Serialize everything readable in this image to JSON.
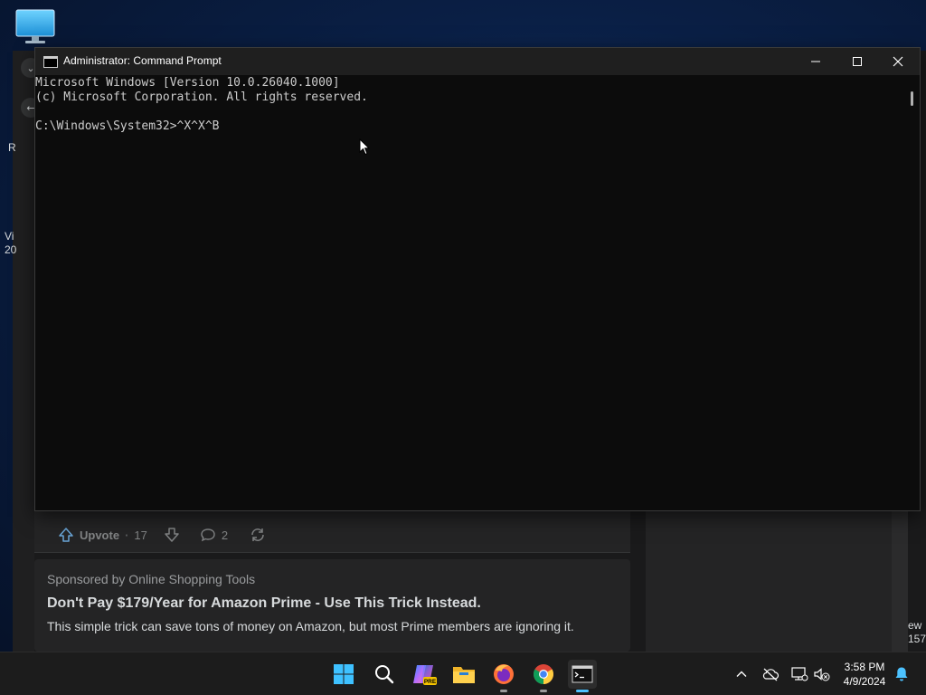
{
  "cmd": {
    "title": "Administrator: Command Prompt",
    "lines": [
      "Microsoft Windows [Version 10.0.26040.1000]",
      "(c) Microsoft Corporation. All rights reserved.",
      "",
      "C:\\Windows\\System32>^X^X^B"
    ]
  },
  "background_browser": {
    "left_strip": {
      "chevron": "⌄",
      "back_arrow": "←",
      "text_r": "R",
      "text_vi": "Vi",
      "text_20": "20"
    },
    "post_actions": {
      "upvote_label": "Upvote",
      "upvote_count": "17",
      "comment_count": "2"
    },
    "ad": {
      "sponsor": "Sponsored by Online Shopping Tools",
      "title": "Don't Pay $179/Year for Amazon Prime - Use This Trick Instead.",
      "body": "This simple trick can save tons of money on Amazon, but most Prime members are ignoring it."
    },
    "right_edge": {
      "text_1": "ew",
      "text_2": "157"
    }
  },
  "taskbar": {
    "apps": [
      {
        "name": "start",
        "icon": "windows-logo-icon"
      },
      {
        "name": "search",
        "icon": "search-icon"
      },
      {
        "name": "copilot",
        "icon": "copilot-icon",
        "badge": "PRE"
      },
      {
        "name": "file-explorer",
        "icon": "folder-icon"
      },
      {
        "name": "firefox",
        "icon": "firefox-icon"
      },
      {
        "name": "chrome",
        "icon": "chrome-icon"
      },
      {
        "name": "terminal",
        "icon": "terminal-icon"
      }
    ],
    "clock": {
      "time": "3:58 PM",
      "date": "4/9/2024"
    }
  },
  "colors": {
    "console_bg": "#0c0c0c",
    "console_text": "#cccccc",
    "titlebar_bg": "#1f1f1f",
    "taskbar_bg": "#1c1c1c",
    "accent": "#4cc2ff"
  }
}
